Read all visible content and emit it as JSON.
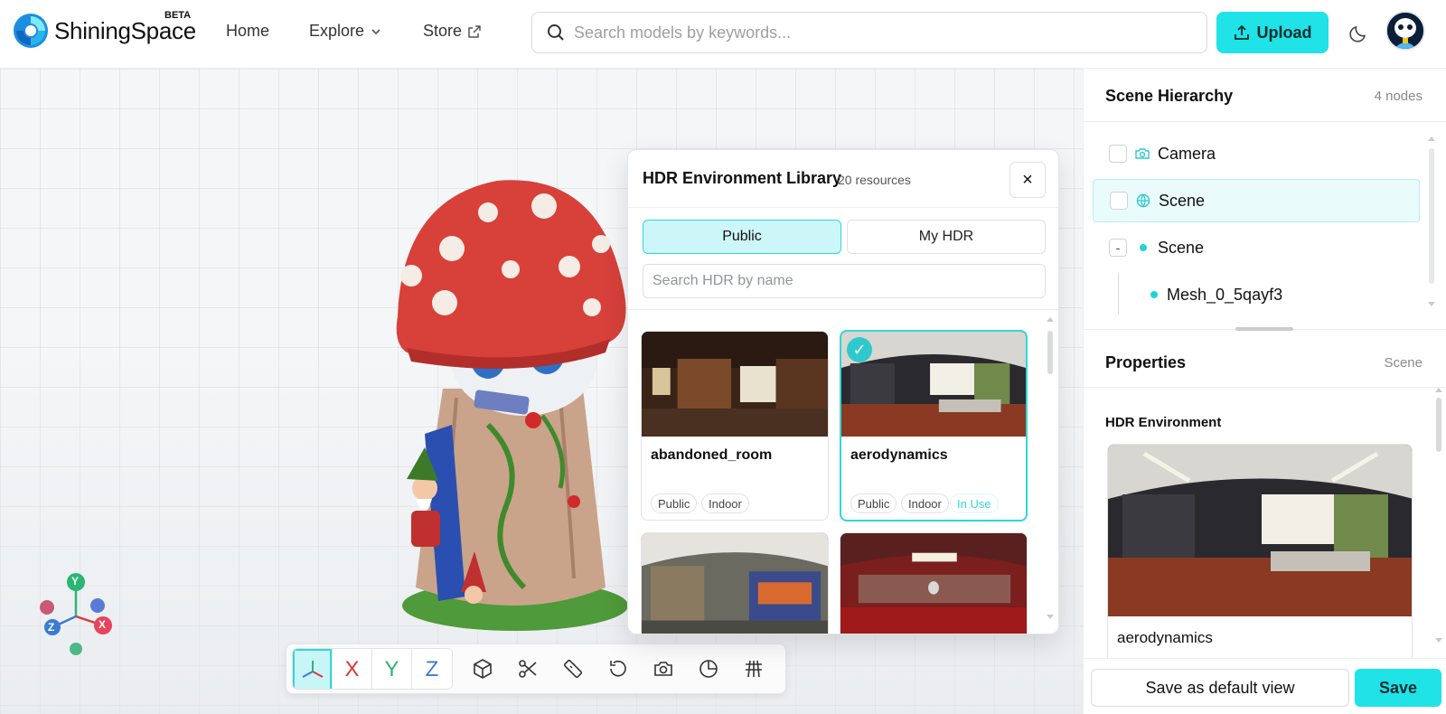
{
  "header": {
    "brand": "ShiningSpace",
    "beta": "BETA",
    "nav": {
      "home": "Home",
      "explore": "Explore",
      "store": "Store"
    },
    "search_placeholder": "Search models by keywords...",
    "upload_label": "Upload"
  },
  "toolbar": {
    "axis_x": "X",
    "axis_y": "Y",
    "axis_z": "Z"
  },
  "gizmo": {
    "y": "Y",
    "z": "Z",
    "x": "X"
  },
  "hdr_dialog": {
    "title": "HDR Environment Library",
    "count": "20 resources",
    "close": "×",
    "tabs": {
      "public": "Public",
      "my_hdr": "My HDR"
    },
    "search_placeholder": "Search HDR by name",
    "cards": [
      {
        "name": "abandoned_room",
        "tags": [
          "Public",
          "Indoor"
        ]
      },
      {
        "name": "aerodynamics",
        "tags": [
          "Public",
          "Indoor",
          "In Use"
        ],
        "selected": true,
        "check": "✓"
      }
    ]
  },
  "scene_hierarchy": {
    "title": "Scene Hierarchy",
    "count": "4 nodes",
    "nodes": [
      {
        "label": "Camera"
      },
      {
        "label": "Scene"
      },
      {
        "label": "Scene",
        "toggle": "-"
      },
      {
        "label": "Mesh_0_5qayf3"
      }
    ]
  },
  "properties": {
    "title": "Properties",
    "context": "Scene",
    "section": "HDR Environment",
    "hdr_name": "aerodynamics"
  },
  "footer": {
    "save_default": "Save as default view",
    "save": "Save"
  },
  "colors": {
    "accent": "#1fe3e6",
    "accent_border": "#33d6da",
    "axis_x": "#d63a3a",
    "axis_y": "#2bb673",
    "axis_z": "#3a7bd5"
  }
}
